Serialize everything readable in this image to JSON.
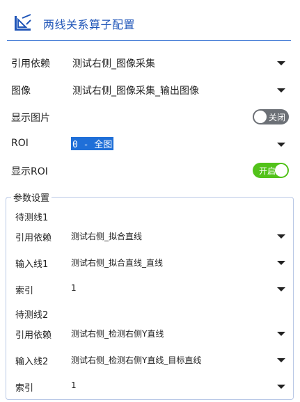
{
  "header": {
    "title": "两线关系算子配置",
    "icon": "ruler-triangle-icon",
    "accent": "#1f55b8"
  },
  "fields": {
    "dependency": {
      "label": "引用依赖",
      "value": "测试右侧_图像采集"
    },
    "image": {
      "label": "图像",
      "value": "测试右侧_图像采集_输出图像"
    },
    "show_image": {
      "label": "显示图片",
      "state": "关闭"
    },
    "roi": {
      "label": "ROI",
      "value": "0 - 全图"
    },
    "show_roi": {
      "label": "显示ROI",
      "state": "开启"
    }
  },
  "params": {
    "title": "参数设置",
    "line1": {
      "title": "待测线1",
      "dependency": {
        "label": "引用依赖",
        "value": "测试右侧_拟合直线"
      },
      "input": {
        "label": "输入线1",
        "value": "测试右侧_拟合直线_直线"
      },
      "index": {
        "label": "索引",
        "value": "1"
      }
    },
    "line2": {
      "title": "待测线2",
      "dependency": {
        "label": "引用依赖",
        "value": "测试右侧_检测右侧Y直线"
      },
      "input": {
        "label": "输入线2",
        "value": "测试右侧_检测右侧Y直线_目标直线"
      },
      "index": {
        "label": "索引",
        "value": "1"
      }
    }
  },
  "colors": {
    "toggle_off": "#6c7076",
    "toggle_on": "#52c21a",
    "selection": "#1f6fd8"
  }
}
